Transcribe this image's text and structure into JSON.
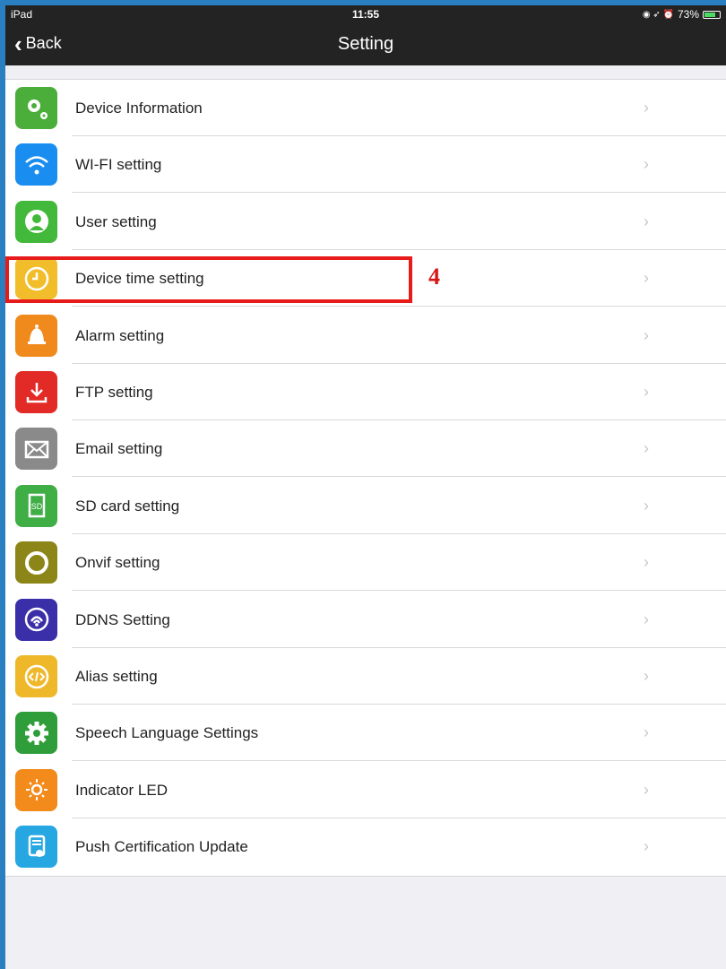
{
  "status_bar": {
    "device": "iPad",
    "time": "11:55",
    "battery": "73%",
    "battery_level": 0.73
  },
  "nav": {
    "back_label": "Back",
    "title": "Setting"
  },
  "annotation": {
    "step_number": "4",
    "highlight_color": "#e81b1b"
  },
  "settings": [
    {
      "label": "Device Information",
      "icon": "gears-icon",
      "color": "#4cae3a"
    },
    {
      "label": "WI-FI setting",
      "icon": "wifi-icon",
      "color": "#1a8ef0"
    },
    {
      "label": "User setting",
      "icon": "user-icon",
      "color": "#42b93a"
    },
    {
      "label": "Device time setting",
      "icon": "clock-icon",
      "color": "#f2bd2b"
    },
    {
      "label": "Alarm setting",
      "icon": "bell-icon",
      "color": "#f08a1c"
    },
    {
      "label": "FTP setting",
      "icon": "download-icon",
      "color": "#e22a26"
    },
    {
      "label": "Email setting",
      "icon": "mail-icon",
      "color": "#8a8a8a"
    },
    {
      "label": "SD card setting",
      "icon": "sd-card-icon",
      "color": "#3fae45"
    },
    {
      "label": "Onvif setting",
      "icon": "onvif-icon",
      "color": "#8c8618"
    },
    {
      "label": "DDNS Setting",
      "icon": "ddns-icon",
      "color": "#3a2fa8"
    },
    {
      "label": "Alias setting",
      "icon": "code-icon",
      "color": "#eeb82a"
    },
    {
      "label": "Speech Language Settings",
      "icon": "gear-icon",
      "color": "#2f9d3a"
    },
    {
      "label": "Indicator LED",
      "icon": "led-icon",
      "color": "#f28a1c"
    },
    {
      "label": "Push Certification Update",
      "icon": "certificate-icon",
      "color": "#27a7e2"
    }
  ],
  "chevron_symbol": "›"
}
